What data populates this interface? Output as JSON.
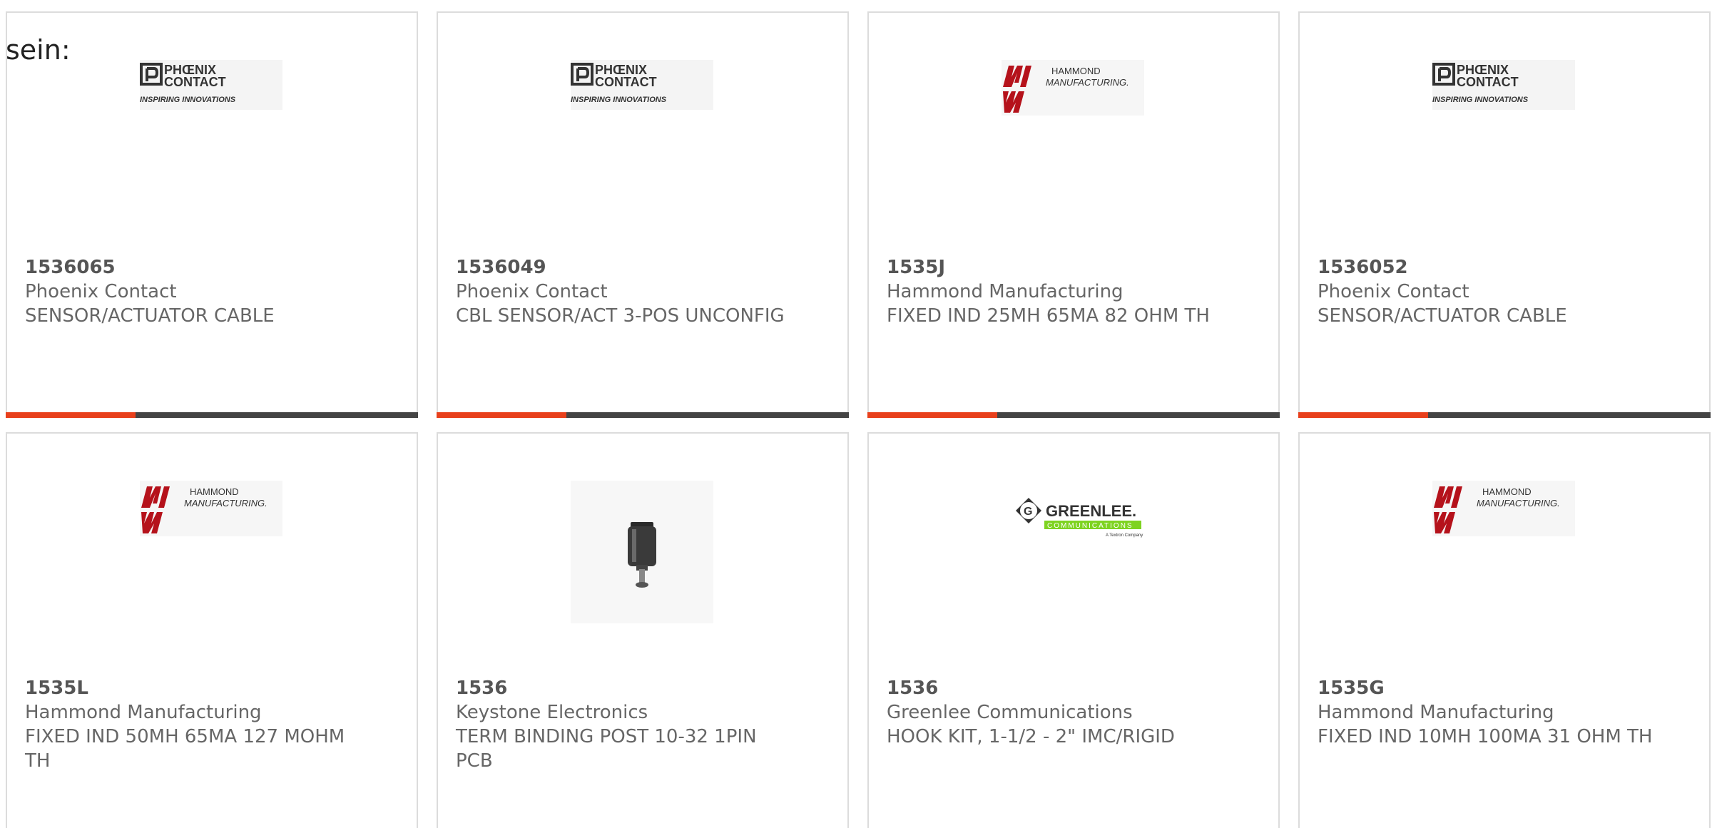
{
  "intro_text": "sein:",
  "colors": {
    "accent": "#e8401c",
    "bar": "#444444",
    "border": "#dcdcdc",
    "phoenix_dark": "#333333",
    "hammond_red": "#b5121b",
    "greenlee_green": "#7ed321"
  },
  "cards": [
    {
      "part_number": "1536065",
      "manufacturer": "Phoenix Contact",
      "description": "SENSOR/ACTUATOR CABLE",
      "logo": "phoenix-contact-logo",
      "logo_text": {
        "line1": "PHŒNIX",
        "line2": "CONTACT",
        "tagline": "INSPIRING INNOVATIONS"
      }
    },
    {
      "part_number": "1536049",
      "manufacturer": "Phoenix Contact",
      "description": "CBL SENSOR/ACT 3-POS UNCONFIG",
      "logo": "phoenix-contact-logo",
      "logo_text": {
        "line1": "PHŒNIX",
        "line2": "CONTACT",
        "tagline": "INSPIRING INNOVATIONS"
      }
    },
    {
      "part_number": "1535J",
      "manufacturer": "Hammond Manufacturing",
      "description": "FIXED IND 25MH 65MA 82 OHM TH",
      "logo": "hammond-manufacturing-logo",
      "logo_text": {
        "line1": "HAMMOND",
        "line2": "MANUFACTURING."
      }
    },
    {
      "part_number": "1536052",
      "manufacturer": "Phoenix Contact",
      "description": "SENSOR/ACTUATOR CABLE",
      "logo": "phoenix-contact-logo",
      "logo_text": {
        "line1": "PHŒNIX",
        "line2": "CONTACT",
        "tagline": "INSPIRING INNOVATIONS"
      }
    },
    {
      "part_number": "1535L",
      "manufacturer": "Hammond Manufacturing",
      "description": "FIXED IND 50MH 65MA 127 MOHM TH",
      "logo": "hammond-manufacturing-logo",
      "logo_text": {
        "line1": "HAMMOND",
        "line2": "MANUFACTURING."
      }
    },
    {
      "part_number": "1536",
      "manufacturer": "Keystone Electronics",
      "description": "TERM BINDING POST 10-32 1PIN PCB",
      "logo": "binding-post-product-image"
    },
    {
      "part_number": "1536",
      "manufacturer": "Greenlee Communications",
      "description": "HOOK KIT, 1-1/2 - 2\" IMC/RIGID",
      "logo": "greenlee-communications-logo",
      "logo_text": {
        "line1": "GREENLEE.",
        "line2": "COMMUNICATIONS",
        "tagline": "A Textron Company"
      }
    },
    {
      "part_number": "1535G",
      "manufacturer": "Hammond Manufacturing",
      "description": "FIXED IND 10MH 100MA 31 OHM TH",
      "logo": "hammond-manufacturing-logo",
      "logo_text": {
        "line1": "HAMMOND",
        "line2": "MANUFACTURING."
      }
    }
  ]
}
